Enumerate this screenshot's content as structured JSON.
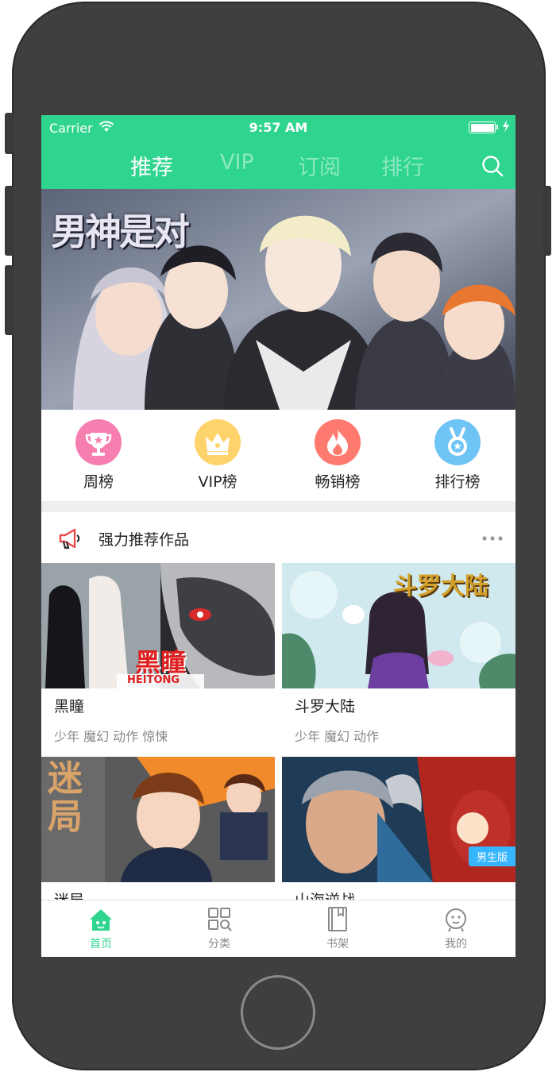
{
  "status_bar": {
    "carrier": "Carrier",
    "time": "9:57 AM"
  },
  "nav": {
    "tabs": [
      {
        "label": "推荐",
        "active": true
      },
      {
        "label": "VIP",
        "active": false
      },
      {
        "label": "订阅",
        "active": false
      },
      {
        "label": "排行",
        "active": false
      }
    ],
    "search_icon": "search-icon"
  },
  "banner": {
    "title": "男神是对",
    "dots": 2,
    "active_dot": 0
  },
  "rankings": [
    {
      "label": "周榜",
      "icon": "trophy-icon",
      "color": "#f67fb0"
    },
    {
      "label": "VIP榜",
      "icon": "crown-icon",
      "color": "#ffd36b"
    },
    {
      "label": "畅销榜",
      "icon": "flame-icon",
      "color": "#ff7a6e"
    },
    {
      "label": "排行榜",
      "icon": "medal-icon",
      "color": "#6ec4f5"
    }
  ],
  "section": {
    "title": "强力推荐作品",
    "icon": "megaphone-icon",
    "more_icon": "more-icon"
  },
  "comics": [
    {
      "title": "黑瞳",
      "tags": "少年 魔幻 动作 惊悚",
      "cover_text": "黑瞳",
      "cover_subtext": "HEITONG"
    },
    {
      "title": "斗罗大陆",
      "tags": "少年 魔幻 动作",
      "cover_text": "斗罗大陆"
    },
    {
      "title": "迷局",
      "tags": "",
      "cover_text": "迷局"
    },
    {
      "title": "山海逆战",
      "tags": "",
      "badge": "男生版"
    }
  ],
  "tabbar": [
    {
      "label": "首页",
      "icon": "home-icon",
      "active": true
    },
    {
      "label": "分类",
      "icon": "category-icon",
      "active": false
    },
    {
      "label": "书架",
      "icon": "bookshelf-icon",
      "active": false
    },
    {
      "label": "我的",
      "icon": "profile-icon",
      "active": false
    }
  ],
  "colors": {
    "brand_green": "#2fd58e",
    "tab_inactive": "#8a8a8a"
  }
}
